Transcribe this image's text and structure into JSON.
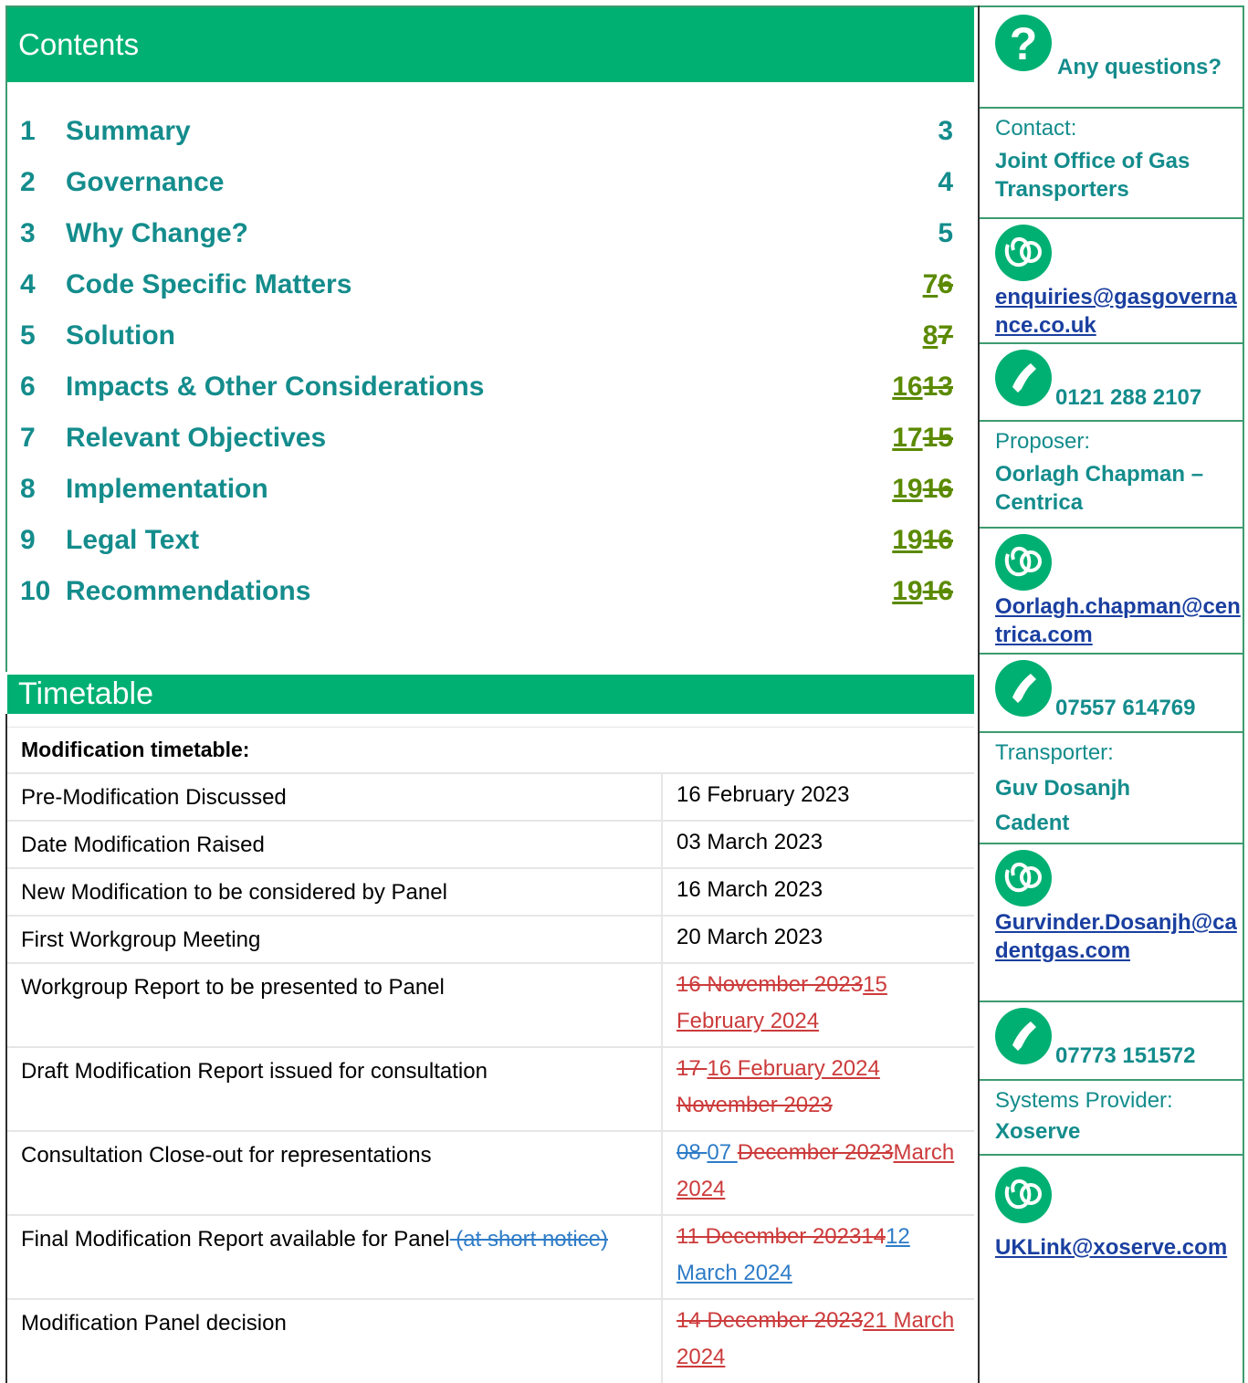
{
  "contents": {
    "title": "Contents",
    "items": [
      {
        "num": "1",
        "title": "Summary",
        "page": "3",
        "ins": "",
        "del": ""
      },
      {
        "num": "2",
        "title": "Governance",
        "page": "4",
        "ins": "",
        "del": ""
      },
      {
        "num": "3",
        "title": "Why Change?",
        "page": "5",
        "ins": "",
        "del": ""
      },
      {
        "num": "4",
        "title": "Code Specific Matters",
        "page": "",
        "ins": "7",
        "del": "6"
      },
      {
        "num": "5",
        "title": "Solution",
        "page": "",
        "ins": "8",
        "del": "7"
      },
      {
        "num": "6",
        "title": "Impacts & Other Considerations",
        "page": "",
        "ins": "16",
        "del": "13"
      },
      {
        "num": "7",
        "title": "Relevant Objectives",
        "page": "",
        "ins": "17",
        "del": "15"
      },
      {
        "num": "8",
        "title": "Implementation",
        "page": "",
        "ins": "19",
        "del": "16"
      },
      {
        "num": "9",
        "title": "Legal Text",
        "page": "",
        "ins": "19",
        "del": "16"
      },
      {
        "num": "10",
        "title": "Recommendations",
        "page": "",
        "ins": "19",
        "del": "16"
      }
    ]
  },
  "timetable": {
    "title": "Timetable",
    "caption": "Modification timetable:",
    "rows": [
      {
        "event": "Pre-Modification Discussed",
        "date": "16 February 2023"
      },
      {
        "event": "Date Modification Raised",
        "date": "03 March 2023"
      },
      {
        "event": "New Modification to be considered by Panel",
        "date": "16 March 2023"
      },
      {
        "event": "First Workgroup Meeting",
        "date": "20 March 2023"
      },
      {
        "event": "Workgroup Report to be presented to Panel",
        "date_del": "16 November 2023",
        "date_ins": "15 February 2024"
      },
      {
        "event": "Draft Modification Report issued for consultation",
        "date_del_a": "17 ",
        "date_ins": "16 February 2024",
        "date_del_b": "November 2023"
      },
      {
        "event": "Consultation Close-out for representations",
        "date_blue_del": "08 ",
        "date_blue_ins": "07 ",
        "date_del": "December 2023",
        "date_ins": "March 2024"
      },
      {
        "event": "Final Modification Report available for Panel",
        "event_del": " (at short notice)",
        "date_del": "11 December 2023",
        "date_del_b": "14",
        "date_ins": "12 March 2024"
      },
      {
        "event": "Modification Panel decision",
        "date_del": "14 December 2023",
        "date_ins": "21 March 2024"
      }
    ]
  },
  "sidebar": {
    "questions": "Any questions?",
    "contact_label": "Contact:",
    "contact_name": "Joint Office of Gas Transporters",
    "contact_email": "enquiries@gasgovernance.co.uk",
    "contact_phone": "0121 288 2107",
    "proposer_label": "Proposer:",
    "proposer_name": "Oorlagh Chapman – Centrica",
    "proposer_email": "Oorlagh.chapman@centrica.com",
    "proposer_phone": "07557 614769",
    "transporter_label": "Transporter:",
    "transporter_name_1": "Guv Dosanjh",
    "transporter_name_2": "Cadent",
    "transporter_email": "Gurvinder.Dosanjh@cadentgas.com",
    "transporter_phone": "07773 151572",
    "systems_label": "Systems Provider:",
    "systems_name": "Xoserve",
    "systems_email": "UKLink@xoserve.com"
  },
  "colors": {
    "header_green": "#00b073",
    "teal_text": "#148c8c",
    "revision_green": "#5b8a00",
    "revision_red": "#cc3b3b",
    "revision_blue": "#2e7cc7",
    "link_blue": "#1a3fa0"
  },
  "icons": {
    "questions": "question-icon",
    "email": "email-icon",
    "phone": "phone-icon"
  }
}
